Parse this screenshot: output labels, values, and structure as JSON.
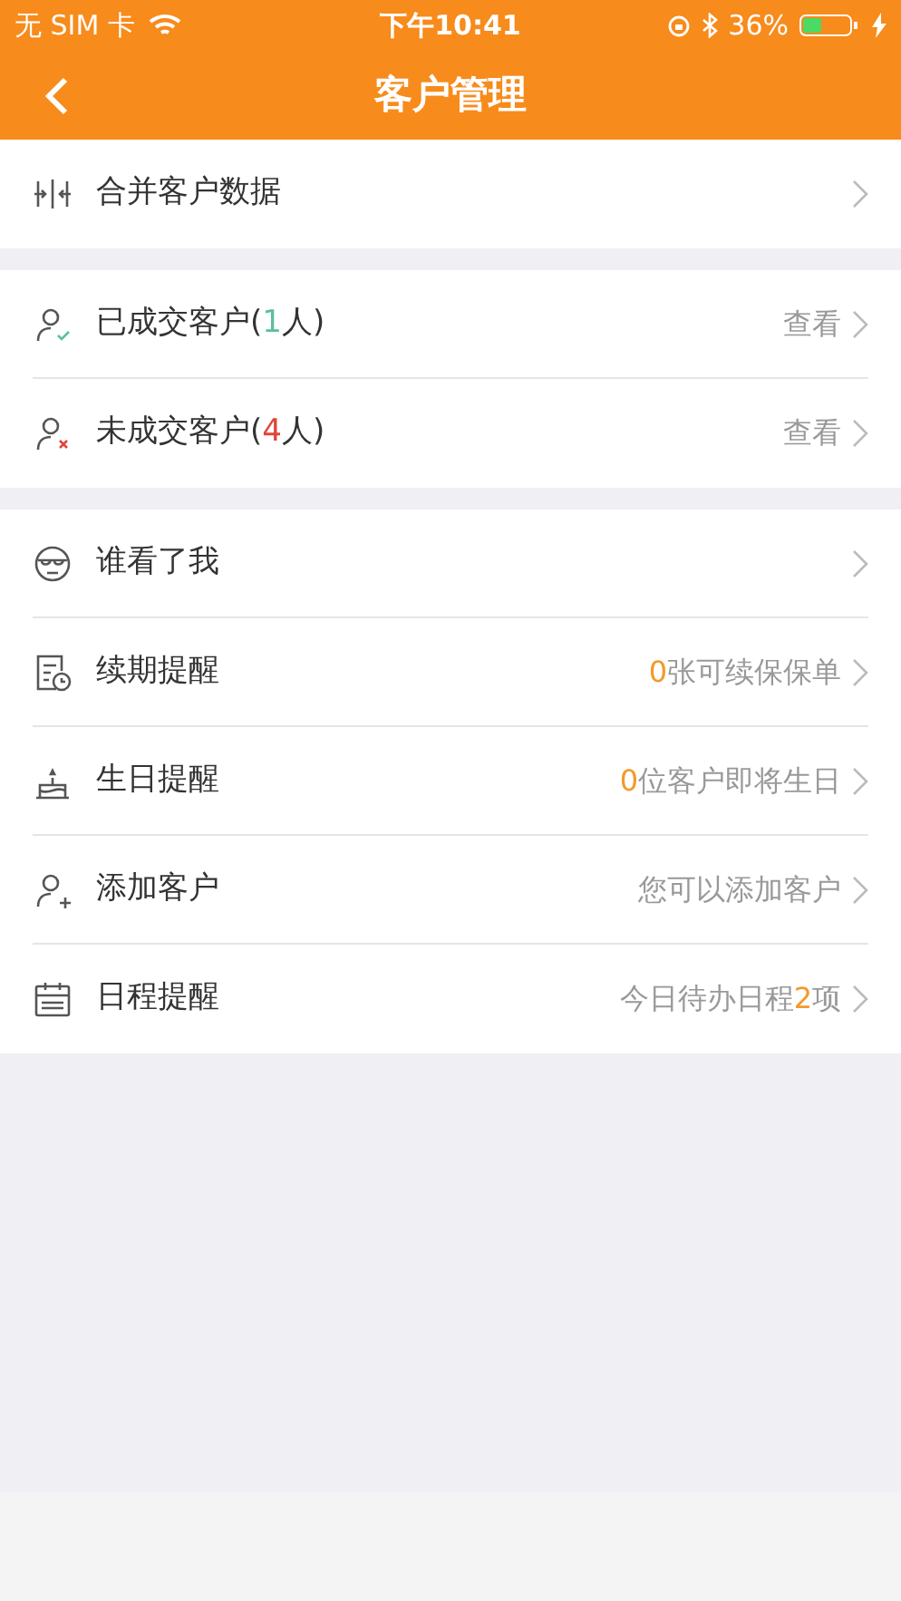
{
  "status_bar": {
    "carrier": "无 SIM 卡",
    "time": "下午10:41",
    "battery": "36%"
  },
  "nav_bar": {
    "title": "客户管理"
  },
  "sections": [
    {
      "rows": [
        {
          "label": [
            {
              "text": "合并客户数据"
            }
          ]
        }
      ]
    },
    {
      "rows": [
        {
          "label": [
            {
              "text": "已成交客户("
            },
            {
              "text": "1",
              "color": "#5cbf9c"
            },
            {
              "text": "人)"
            }
          ],
          "detail": [
            {
              "text": "查看"
            }
          ]
        },
        {
          "label": [
            {
              "text": "未成交客户("
            },
            {
              "text": "4",
              "color": "#e0453a"
            },
            {
              "text": "人)"
            }
          ],
          "detail": [
            {
              "text": "查看"
            }
          ]
        }
      ]
    },
    {
      "rows": [
        {
          "label": [
            {
              "text": "谁看了我"
            }
          ]
        },
        {
          "label": [
            {
              "text": "续期提醒"
            }
          ],
          "detail": [
            {
              "text": "0",
              "color": "#f39a2b"
            },
            {
              "text": "张可续保保单"
            }
          ]
        },
        {
          "label": [
            {
              "text": "生日提醒"
            }
          ],
          "detail": [
            {
              "text": "0",
              "color": "#f39a2b"
            },
            {
              "text": "位客户即将生日"
            }
          ]
        },
        {
          "label": [
            {
              "text": "添加客户"
            }
          ],
          "detail": [
            {
              "text": "您可以添加客户"
            }
          ]
        },
        {
          "label": [
            {
              "text": "日程提醒"
            }
          ],
          "detail": [
            {
              "text": "今日待办日程"
            },
            {
              "text": "2",
              "color": "#f39a2b"
            },
            {
              "text": "项"
            }
          ]
        }
      ]
    }
  ]
}
